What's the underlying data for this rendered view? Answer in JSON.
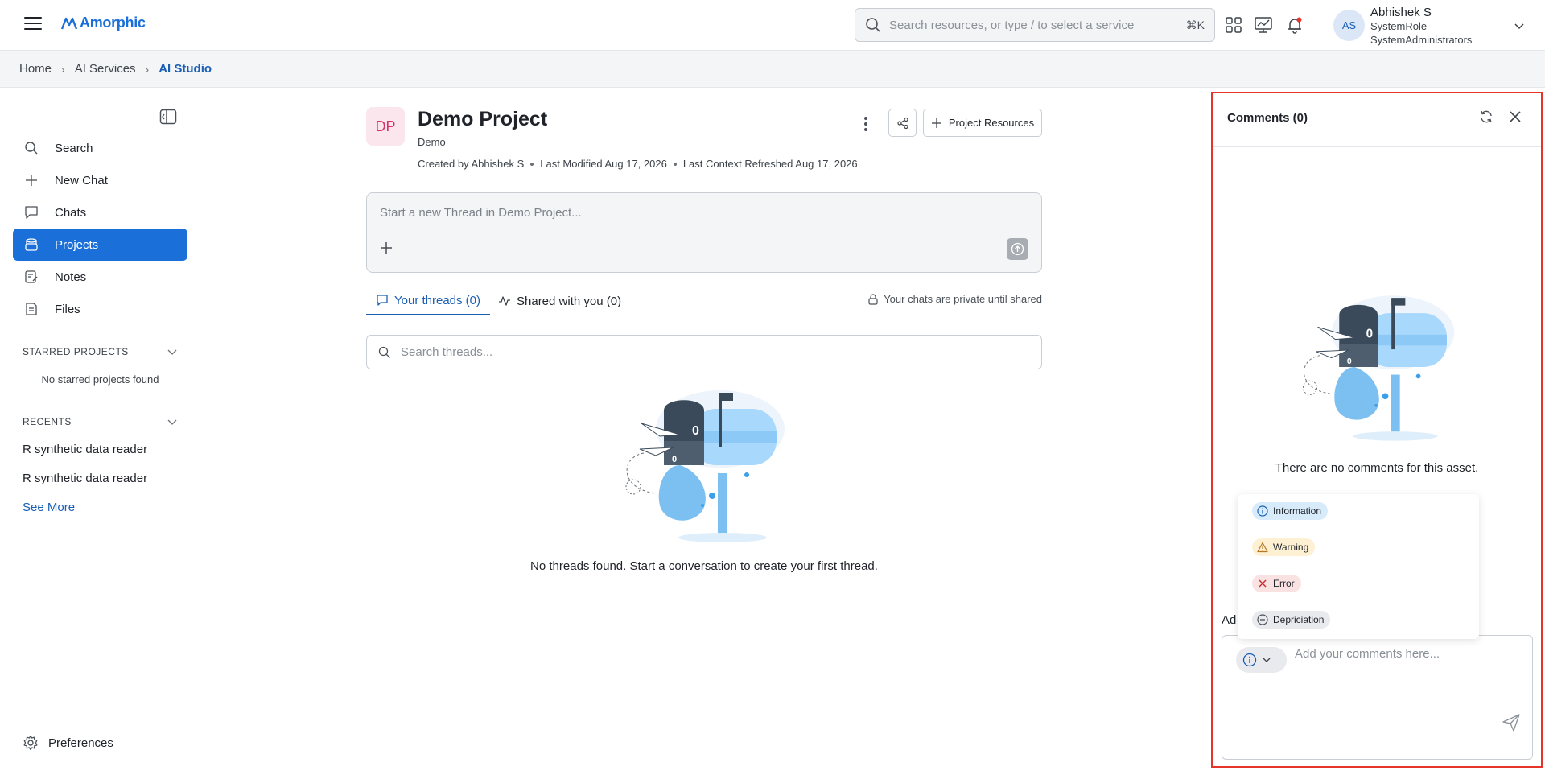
{
  "header": {
    "app_name": "Amorphic",
    "search_placeholder": "Search resources, or type / to select a service",
    "search_shortcut": "⌘K",
    "user": {
      "initials": "AS",
      "name": "Abhishek S",
      "role": "SystemRole-SystemAdministrators"
    }
  },
  "breadcrumb": {
    "items": [
      "Home",
      "AI Services"
    ],
    "current": "AI Studio"
  },
  "sidebar": {
    "nav": [
      {
        "label": "Search",
        "icon": "search-icon"
      },
      {
        "label": "New Chat",
        "icon": "plus-icon"
      },
      {
        "label": "Chats",
        "icon": "chat-bubble-icon"
      },
      {
        "label": "Projects",
        "icon": "projects-icon",
        "active": true
      },
      {
        "label": "Notes",
        "icon": "notes-icon"
      },
      {
        "label": "Files",
        "icon": "file-icon"
      }
    ],
    "starred": {
      "title": "STARRED PROJECTS",
      "empty": "No starred projects found"
    },
    "recents": {
      "title": "RECENTS",
      "items": [
        "R synthetic data reader",
        "R synthetic data reader"
      ],
      "see_more": "See More"
    },
    "preferences": "Preferences"
  },
  "project": {
    "initials": "DP",
    "title": "Demo Project",
    "subtitle": "Demo",
    "meta": [
      "Created by Abhishek S",
      "Last Modified Aug 17, 2026",
      "Last Context Refreshed Aug 17, 2026"
    ],
    "resources_button": "Project Resources",
    "composer_placeholder": "Start a new Thread in Demo Project...",
    "tabs": [
      "Your threads (0)",
      "Shared with you (0)"
    ],
    "private_note": "Your chats are private until shared",
    "thread_search_placeholder": "Search threads...",
    "empty_text": "No threads found. Start a conversation to create your first thread."
  },
  "comments": {
    "title": "Comments (0)",
    "empty_text": "There are no comments for this asset.",
    "types": [
      {
        "label": "Information",
        "color": "#d7ebfb",
        "icon": "info-icon"
      },
      {
        "label": "Warning",
        "color": "#fdf0d3",
        "icon": "warning-icon"
      },
      {
        "label": "Error",
        "color": "#fbe2e2",
        "icon": "x-icon"
      },
      {
        "label": "Depriciation",
        "color": "#e8eaed",
        "icon": "minus-circle-icon"
      }
    ],
    "add_label": "Ad",
    "placeholder": "Add your comments here..."
  },
  "colors": {
    "accent": "#1a6fd8",
    "highlight_border": "#e5352b"
  }
}
